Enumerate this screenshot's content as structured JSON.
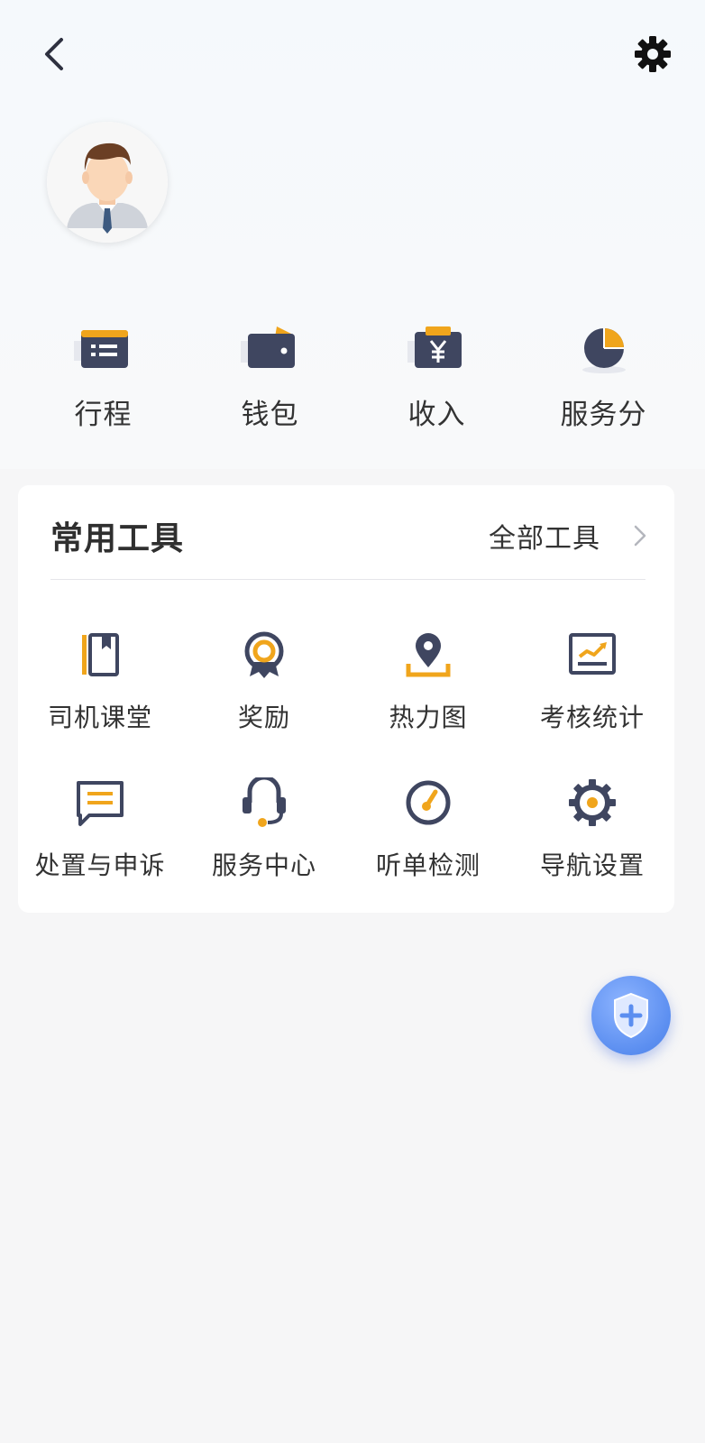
{
  "header": {
    "quick_actions": [
      {
        "label": "行程",
        "icon": "trip-icon"
      },
      {
        "label": "钱包",
        "icon": "wallet-icon"
      },
      {
        "label": "收入",
        "icon": "income-icon"
      },
      {
        "label": "服务分",
        "icon": "service-score-icon"
      }
    ]
  },
  "tools": {
    "title": "常用工具",
    "all_label": "全部工具",
    "items": [
      {
        "label": "司机课堂",
        "icon": "book-icon"
      },
      {
        "label": "奖励",
        "icon": "medal-icon"
      },
      {
        "label": "热力图",
        "icon": "map-pin-icon"
      },
      {
        "label": "考核统计",
        "icon": "stats-chart-icon"
      },
      {
        "label": "处置与申诉",
        "icon": "message-icon"
      },
      {
        "label": "服务中心",
        "icon": "headset-icon"
      },
      {
        "label": "听单检测",
        "icon": "gauge-icon"
      },
      {
        "label": "导航设置",
        "icon": "gear-icon"
      }
    ]
  },
  "colors": {
    "icon_dark": "#3f4660",
    "icon_accent": "#f0a51c",
    "fab_blue": "#5b8ef0"
  }
}
